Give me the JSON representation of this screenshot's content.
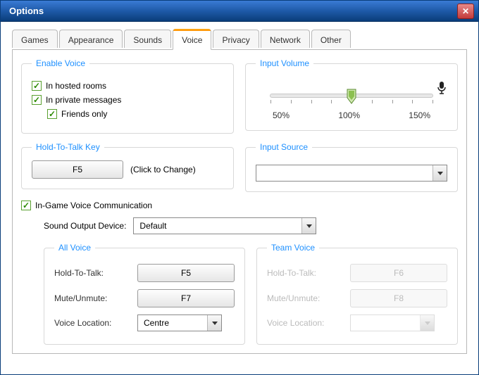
{
  "window": {
    "title": "Options"
  },
  "tabs": {
    "games": "Games",
    "appearance": "Appearance",
    "sounds": "Sounds",
    "voice": "Voice",
    "privacy": "Privacy",
    "network": "Network",
    "other": "Other"
  },
  "enable_voice": {
    "legend": "Enable Voice",
    "hosted": "In hosted rooms",
    "private": "In private messages",
    "friends": "Friends only"
  },
  "input_volume": {
    "legend": "Input Volume",
    "l50": "50%",
    "l100": "100%",
    "l150": "150%"
  },
  "hold_key": {
    "legend": "Hold-To-Talk Key",
    "key": "F5",
    "hint": "(Click to Change)"
  },
  "input_source": {
    "legend": "Input Source",
    "value": ""
  },
  "ingame": {
    "label": "In-Game Voice Communication",
    "device_label": "Sound Output Device:",
    "device_value": "Default"
  },
  "all_voice": {
    "legend": "All Voice",
    "hold_label": "Hold-To-Talk:",
    "hold_key": "F5",
    "mute_label": "Mute/Unmute:",
    "mute_key": "F7",
    "loc_label": "Voice Location:",
    "loc_value": "Centre"
  },
  "team_voice": {
    "legend": "Team Voice",
    "hold_label": "Hold-To-Talk:",
    "hold_key": "F6",
    "mute_label": "Mute/Unmute:",
    "mute_key": "F8",
    "loc_label": "Voice Location:",
    "loc_value": ""
  }
}
